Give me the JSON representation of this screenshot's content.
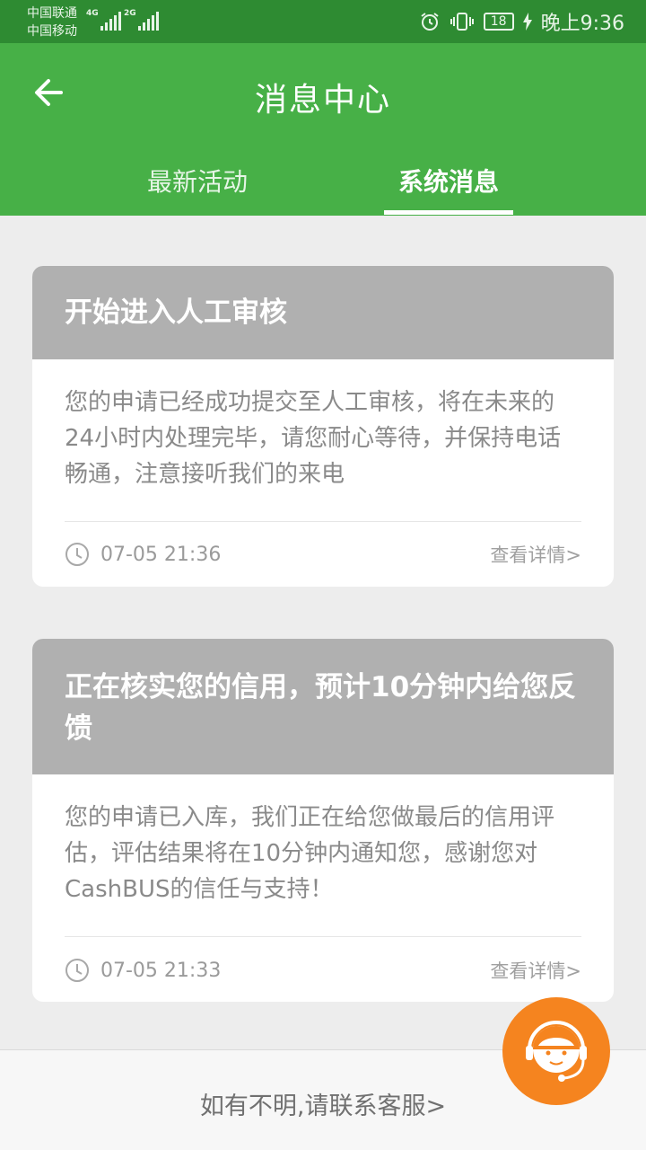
{
  "status_bar": {
    "carrier1": "中国联通",
    "carrier2": "中国移动",
    "net1": "4G",
    "net2": "2G",
    "battery": "18",
    "time": "晚上9:36",
    "icons": [
      "alarm-icon",
      "vibrate-icon",
      "battery-icon",
      "charging-icon"
    ]
  },
  "header": {
    "title": "消息中心",
    "back_icon": "back-arrow-icon",
    "tabs": [
      {
        "label": "最新活动",
        "active": false
      },
      {
        "label": "系统消息",
        "active": true
      }
    ]
  },
  "messages": [
    {
      "title": "开始进入人工审核",
      "body": "您的申请已经成功提交至人工审核，将在未来的24小时内处理完毕，请您耐心等待，并保持电话畅通，注意接听我们的来电",
      "time": "07-05 21:36",
      "detail_label": "查看详情>"
    },
    {
      "title": "正在核实您的信用，预计10分钟内给您反馈",
      "body": "您的申请已入库，我们正在给您做最后的信用评估，评估结果将在10分钟内通知您，感谢您对CashBUS的信任与支持！",
      "time": "07-05 21:33",
      "detail_label": "查看详情>"
    }
  ],
  "footer": {
    "text": "如有不明,请联系客服>"
  },
  "colors": {
    "header": "#47b047",
    "status_bar": "#2e8b32",
    "card_head": "#b0b0b0",
    "service": "#f5841f"
  }
}
